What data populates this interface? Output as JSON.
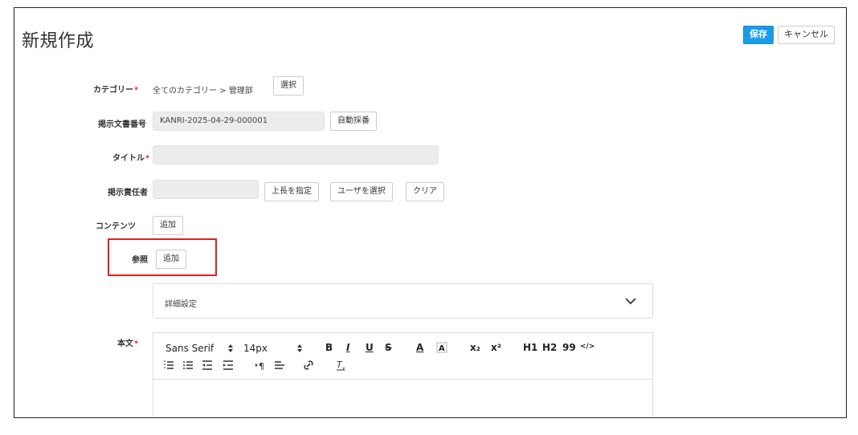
{
  "page": {
    "title": "新規作成"
  },
  "header": {
    "save_label": "保存",
    "cancel_label": "キャンセル"
  },
  "form": {
    "category": {
      "label": "カテゴリー",
      "path": "全てのカテゴリー > 管理部",
      "select_label": "選択"
    },
    "doc_number": {
      "label": "掲示文書番号",
      "value": "KANRI-2025-04-29-000001",
      "auto_label": "自動採番"
    },
    "title": {
      "label": "タイトル",
      "value": ""
    },
    "responsible": {
      "label": "掲示責任者",
      "value": "",
      "boss_label": "上長を指定",
      "user_label": "ユーザを選択",
      "clear_label": "クリア"
    },
    "contents": {
      "label": "コンテンツ",
      "add_label": "追加"
    },
    "reference": {
      "label": "参照",
      "add_label": "追加"
    },
    "details": {
      "label": "詳細設定"
    },
    "body": {
      "label": "本文"
    }
  },
  "editor": {
    "font_family": "Sans Serif",
    "font_size": "14px",
    "bold": "B",
    "italic": "I",
    "underline": "U",
    "strike": "S",
    "color": "A",
    "subscript": "x₂",
    "superscript": "x²",
    "h1": "H1",
    "h2": "H2",
    "quote": "99",
    "code": "</>"
  },
  "colors": {
    "primary": "#1a9be8",
    "required": "#e03030",
    "highlight": "#e02020"
  }
}
